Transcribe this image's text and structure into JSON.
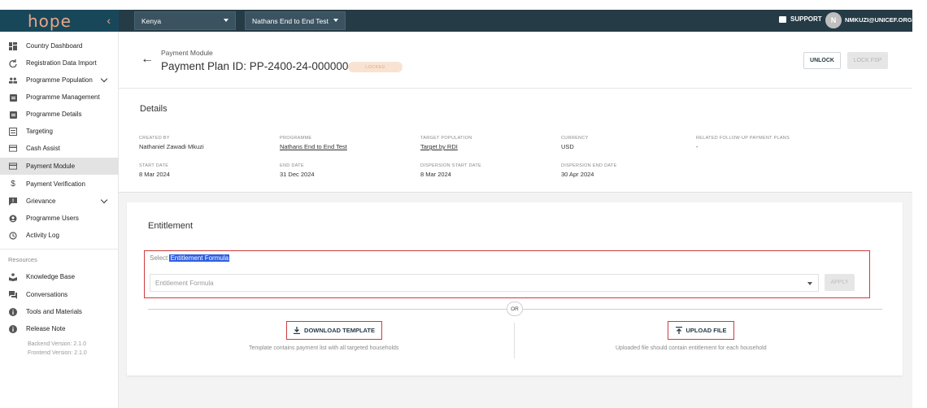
{
  "topbar": {
    "logo": "hope",
    "country": "Kenya",
    "programme": "Nathans End to End Test",
    "support_label": "SUPPORT",
    "avatar_initial": "N",
    "user_email": "NMKUZI@UNICEF.ORG"
  },
  "sidebar": {
    "items": [
      {
        "label": "Country Dashboard",
        "icon": "dashboard-icon"
      },
      {
        "label": "Registration Data Import",
        "icon": "refresh-icon"
      },
      {
        "label": "Programme Population",
        "icon": "people-icon"
      },
      {
        "label": "Programme Management",
        "icon": "clipboard-icon"
      },
      {
        "label": "Programme Details",
        "icon": "clipboard-icon"
      },
      {
        "label": "Targeting",
        "icon": "target-list-icon"
      },
      {
        "label": "Cash Assist",
        "icon": "card-icon"
      },
      {
        "label": "Payment Module",
        "icon": "card-icon"
      },
      {
        "label": "Payment Verification",
        "icon": "dollar-icon"
      },
      {
        "label": "Grievance",
        "icon": "feedback-icon"
      },
      {
        "label": "Programme Users",
        "icon": "user-circle-icon"
      },
      {
        "label": "Activity Log",
        "icon": "history-icon"
      }
    ],
    "resources_label": "Resources",
    "resources": [
      {
        "label": "Knowledge Base",
        "icon": "knowledge-icon"
      },
      {
        "label": "Conversations",
        "icon": "forum-icon"
      },
      {
        "label": "Tools and Materials",
        "icon": "info-icon"
      },
      {
        "label": "Release Note",
        "icon": "info-icon"
      }
    ],
    "backend_version": "Backend Version: 2.1.0",
    "frontend_version": "Frontend Version: 2.1.0"
  },
  "header": {
    "module": "Payment Module",
    "title": "Payment Plan ID: PP-2400-24-00000041",
    "status": "LOCKED",
    "unlock_label": "UNLOCK",
    "lock_fsp_label": "LOCK FSP"
  },
  "details": {
    "title": "Details",
    "created_by_label": "CREATED BY",
    "created_by": "Nathaniel Zawadi Mkuzi",
    "programme_label": "PROGRAMME",
    "programme": "Nathans End to End Test",
    "target_population_label": "TARGET POPULATION",
    "target_population": "Target by RDI",
    "currency_label": "CURRENCY",
    "currency": "USD",
    "related_label": "RELATED FOLLOW-UP PAYMENT PLANS",
    "related": "-",
    "start_date_label": "START DATE",
    "start_date": "8 Mar 2024",
    "end_date_label": "END DATE",
    "end_date": "31 Dec 2024",
    "dispersion_start_label": "DISPERSION START DATE",
    "dispersion_start": "8 Mar 2024",
    "dispersion_end_label": "DISPERSION END DATE",
    "dispersion_end": "30 Apr 2024"
  },
  "entitlement": {
    "title": "Entitlement",
    "select_prefix": "Select",
    "select_highlight": "Entitlement Formula",
    "formula_placeholder": "Entitlement Formula",
    "apply_label": "APPLY",
    "or_label": "OR",
    "download_label": "DOWNLOAD TEMPLATE",
    "download_hint": "Template contains payment list with all targeted households",
    "upload_label": "UPLOAD FILE",
    "upload_hint": "Uploaded file should contain entitlement for each household"
  },
  "colors": {
    "topbar": "#253b46",
    "logo_bg": "#19475a",
    "logo": "#e8a68a",
    "highlight_box": "#cd3b3e",
    "selection": "#2f5fe0",
    "status_badge_bg": "#f8e3d3",
    "status_badge_text": "#e9a87d"
  }
}
